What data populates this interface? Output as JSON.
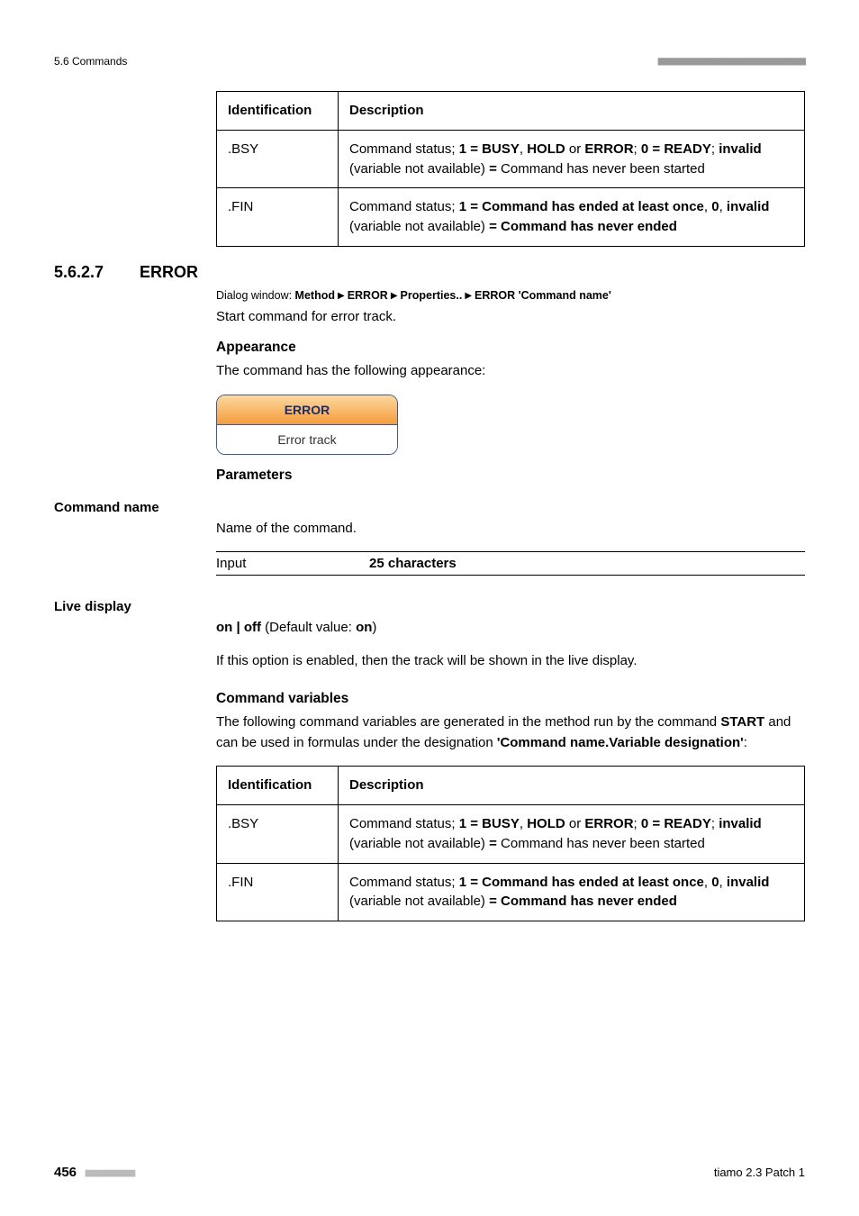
{
  "header": {
    "left": "5.6 Commands",
    "right_dashes": "■■■■■■■■■■■■■■■■■■■■■■"
  },
  "table1": {
    "head_id": "Identification",
    "head_desc": "Description",
    "rows": [
      {
        "id": ".BSY",
        "desc_pre": "Command status; ",
        "b1": "1 = BUSY",
        "sep1": ", ",
        "b2": "HOLD",
        "sep2": " or ",
        "b3": "ERROR",
        "sep3": "; ",
        "b4": "0 = READY",
        "sep4": "; ",
        "b5": "invalid",
        "mid": " (variable not available) ",
        "b6": "=",
        "tail": " Command has never been started"
      },
      {
        "id": ".FIN",
        "desc_pre": "Command status; ",
        "b1": "1 = Command has ended at least once",
        "sep1": ", ",
        "b2": "0",
        "sep2": ", ",
        "b3": "invalid",
        "mid": " (variable not available) ",
        "b4": "= Command has never ended"
      }
    ]
  },
  "section": {
    "number": "5.6.2.7",
    "title": "ERROR",
    "dialog_prefix": "Dialog window: ",
    "dialog_parts": [
      "Method",
      "ERROR",
      "Properties..",
      "ERROR 'Command name'"
    ],
    "intro": "Start command for error track.",
    "appearance_head": "Appearance",
    "appearance_text": "The command has the following appearance:",
    "widget_top": "ERROR",
    "widget_bottom": "Error track",
    "parameters_head": "Parameters",
    "cmdname_label": "Command name",
    "cmdname_text": "Name of the command.",
    "input_label": "Input",
    "input_value": "25 characters",
    "live_label": "Live display",
    "live_prefix": "on | off",
    "live_default_open": " (Default value: ",
    "live_default_val": "on",
    "live_default_close": ")",
    "live_text": "If this option is enabled, then the track will be shown in the live display.",
    "cmdvars_head": "Command variables",
    "cmdvars_p1a": "The following command variables are generated in the method run by the command ",
    "cmdvars_p1b": "START",
    "cmdvars_p1c": " and can be used in formulas under the designation ",
    "cmdvars_p1d": "'Command name.Variable designation'",
    "cmdvars_p1e": ":"
  },
  "footer": {
    "page": "456",
    "dashes": "■■■■■■■■",
    "right": "tiamo 2.3 Patch 1"
  }
}
